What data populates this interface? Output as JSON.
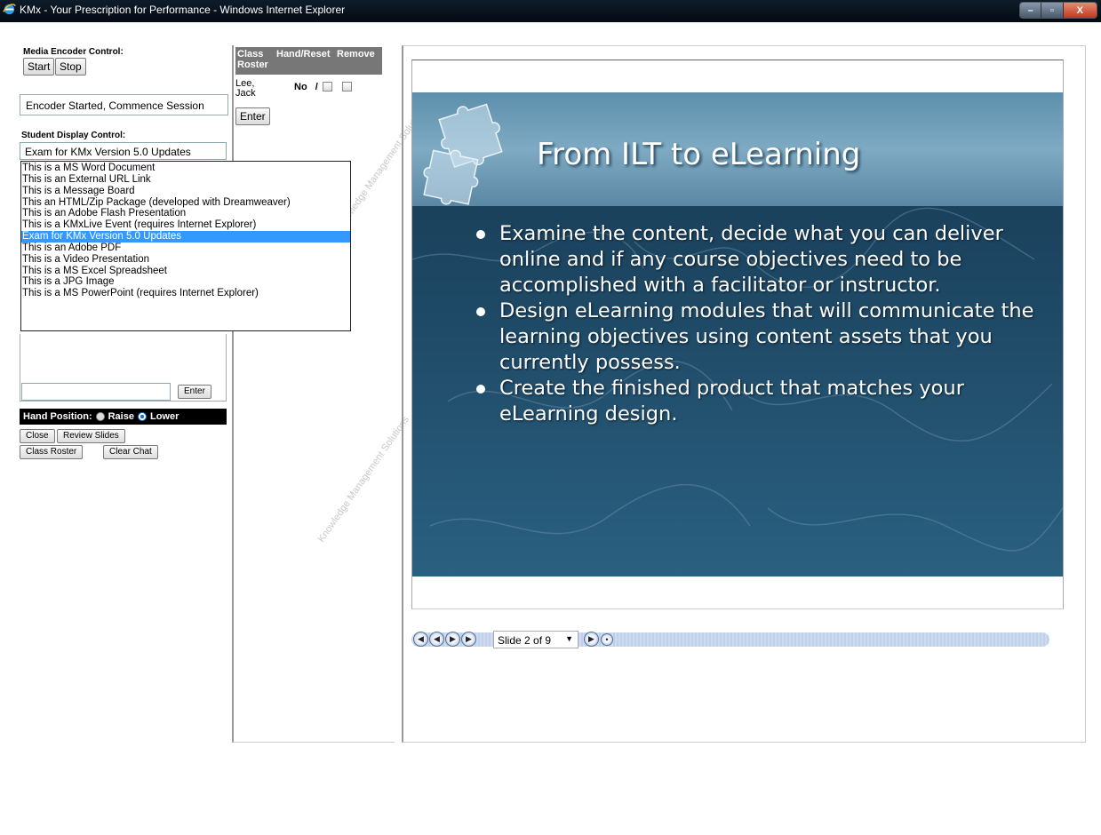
{
  "window": {
    "title": "KMx - Your Prescription for Performance - Windows Internet Explorer"
  },
  "encoder": {
    "label": "Media Encoder Control:",
    "start_label": "Start",
    "stop_label": "Stop",
    "status": "Encoder Started, Commence Session"
  },
  "student_display": {
    "label": "Student Display Control:",
    "selected": "Exam for KMx Version 5.0 Updates",
    "options": [
      "This is a MS Word Document",
      "This is an External URL Link",
      "This is a Message Board",
      "This an HTML/Zip Package (developed with Dreamweaver)",
      "This is an Adobe Flash Presentation",
      "This is a KMxLive Event (requires Internet Explorer)",
      "Exam for KMx Version 5.0 Updates",
      "This is an Adobe PDF",
      "This is a Video Presentation",
      "This is a MS Excel Spreadsheet",
      "This is a JPG Image",
      "This is a MS PowerPoint (requires Internet Explorer)"
    ]
  },
  "chat": {
    "enter_label": "Enter"
  },
  "hand": {
    "label": "Hand Position:",
    "raise_label": "Raise",
    "lower_label": "Lower",
    "selected": "Lower"
  },
  "bottom_buttons": {
    "close": "Close",
    "review": "Review Slides",
    "roster": "Class Roster",
    "clear_chat": "Clear Chat"
  },
  "roster": {
    "headers": [
      "Class Roster",
      "Hand/Reset",
      "Remove"
    ],
    "name_line1": "Lee,",
    "name_line2": "Jack",
    "hand_status": "No",
    "separator": "/",
    "enter_label": "Enter"
  },
  "slide": {
    "title": "From ILT to eLearning",
    "bullets": [
      "Examine the content, decide what you can deliver online and if any course objectives need to be accomplished with a facilitator or instructor.",
      "Design eLearning modules that will communicate the learning objectives using content assets that you currently possess.",
      "Create the finished product that matches your eLearning design."
    ]
  },
  "player": {
    "slide_indicator": "Slide 2 of 9",
    "current_slide": 2,
    "total_slides": 9
  },
  "watermark": "Knowledge Management Solutions"
}
